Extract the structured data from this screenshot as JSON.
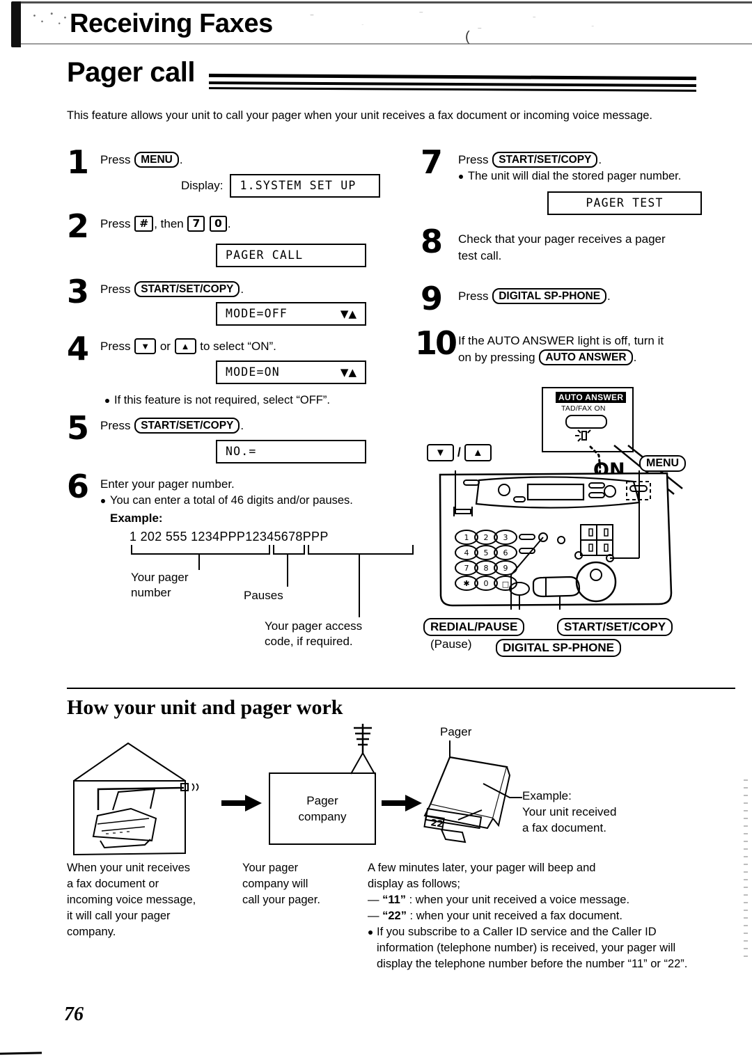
{
  "header": {
    "running_title": "Receiving Faxes"
  },
  "section": {
    "title": "Pager call"
  },
  "intro": "This feature allows your unit to call your pager when your unit receives a fax document or incoming voice message.",
  "steps_left": [
    {
      "num": "1",
      "text_before": "Press",
      "key": "MENU",
      "text_after": ".",
      "display_label": "Display:",
      "lcd": "1.SYSTEM SET UP"
    },
    {
      "num": "2",
      "text_before": "Press",
      "key1": "#",
      "text_mid": ", then",
      "key2": "7",
      "key3": "0",
      "text_after": ".",
      "lcd": "PAGER CALL"
    },
    {
      "num": "3",
      "text_before": "Press",
      "key": "START/SET/COPY",
      "text_after": ".",
      "lcd": "MODE=OFF",
      "lcd_arrows": "▼▲"
    },
    {
      "num": "4",
      "text_before": "Press",
      "key1": "▼",
      "text_mid": "or",
      "key2": "▲",
      "text_after": "to select “ON”.",
      "lcd": "MODE=ON",
      "lcd_arrows": "▼▲",
      "note": "If this feature is not required, select “OFF”."
    },
    {
      "num": "5",
      "text_before": "Press",
      "key": "START/SET/COPY",
      "text_after": ".",
      "lcd": "NO.="
    },
    {
      "num": "6",
      "line1": "Enter your pager number.",
      "bullet": "You can enter a total of 46 digits and/or pauses.",
      "example_label": "Example:",
      "example_number": "1 202 555 1234PPP12345678PPP",
      "brace_labels": {
        "pager_number": "Your pager\nnumber",
        "pauses": "Pauses",
        "access_code": "Your pager access\ncode, if required."
      }
    }
  ],
  "steps_right": [
    {
      "num": "7",
      "text_before": "Press",
      "key": "START/SET/COPY",
      "text_after": ".",
      "bullet": "The unit will dial the stored pager number.",
      "lcd": "PAGER TEST"
    },
    {
      "num": "8",
      "line1": "Check that your pager receives a pager",
      "line2": "test call."
    },
    {
      "num": "9",
      "text_before": "Press",
      "key": "DIGITAL SP-PHONE",
      "text_after": "."
    },
    {
      "num": "10",
      "line1": "If the AUTO ANSWER light is off, turn it",
      "line2_before": "on by pressing",
      "key": "AUTO ANSWER",
      "line2_after": "."
    }
  ],
  "machine": {
    "auto_answer_label": "AUTO ANSWER",
    "tad_fax_label": "TAD/FAX ON",
    "on_label": "ON",
    "menu_key": "MENU",
    "down_key": "▼",
    "slash": "/",
    "up_key": "▲",
    "redial_key": "REDIAL/PAUSE",
    "pause_note": "(Pause)",
    "digital_sp_phone_key": "DIGITAL SP-PHONE",
    "start_set_copy_key": "START/SET/COPY",
    "keypad": [
      "1",
      "2",
      "3",
      "4",
      "5",
      "6",
      "7",
      "8",
      "9",
      "✱",
      "0",
      "□"
    ]
  },
  "how_section": {
    "title": "How your unit and pager work",
    "pager_company_label": "Pager\ncompany",
    "pager_label": "Pager",
    "pager_display_value": "22",
    "pager_example": "Example:\nYour unit received\na fax document.",
    "caption1": "When your unit receives a fax document or incoming voice message, it will call your pager company.",
    "caption2": "Your pager company will call your pager.",
    "caption3_lines": [
      "A few minutes later, your pager will beep and",
      "display as follows;"
    ],
    "caption3_items": [
      {
        "dash": "—",
        "code": "“11”",
        "rest": " : when your unit received a voice message."
      },
      {
        "dash": "—",
        "code": "“22”",
        "rest": " : when your unit received a fax document."
      }
    ],
    "caption3_bullet": "If you subscribe to a Caller ID service and the Caller ID information (telephone number) is received, your pager will display the telephone number before the number “11” or “22”."
  },
  "page_number": "76"
}
